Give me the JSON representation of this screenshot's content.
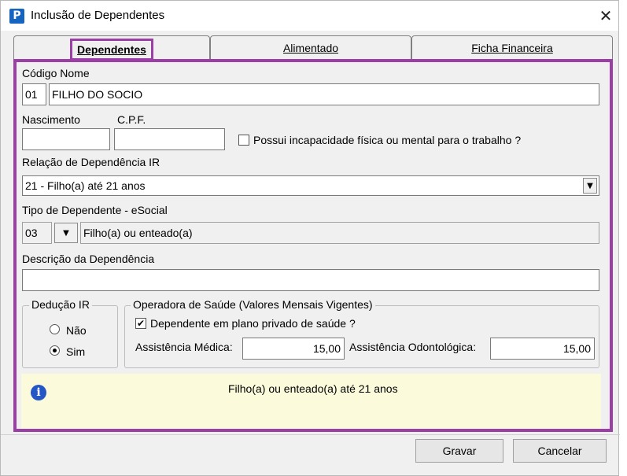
{
  "window": {
    "title": "Inclusão de Dependentes"
  },
  "tabs": [
    {
      "label": "Dependentes",
      "active": true
    },
    {
      "label": "Alimentado",
      "active": false
    },
    {
      "label": "Ficha Financeira",
      "active": false
    }
  ],
  "form": {
    "codigo_nome_label": "Código Nome",
    "codigo_value": "01",
    "nome_value": "FILHO DO SOCIO",
    "nascimento_label": "Nascimento",
    "nascimento_value": "",
    "cpf_label": "C.P.F.",
    "cpf_value": "",
    "incapacidade_label": "Possui incapacidade física ou mental para o trabalho ?",
    "incapacidade_checked": false,
    "relacao_label": "Relação de Dependência IR",
    "relacao_value": "21 - Filho(a) até 21 anos",
    "tipo_label": "Tipo de Dependente - eSocial",
    "tipo_code": "03",
    "tipo_desc": "Filho(a) ou enteado(a)",
    "descricao_label": "Descrição da Dependência",
    "descricao_value": ""
  },
  "deducao": {
    "legend": "Dedução IR",
    "options": [
      {
        "label": "Não",
        "selected": false
      },
      {
        "label": "Sim",
        "selected": true
      }
    ]
  },
  "operadora": {
    "legend": "Operadora de Saúde (Valores Mensais Vigentes)",
    "plano_label": "Dependente em plano privado de saúde ?",
    "plano_checked": true,
    "medica_label": "Assistência Médica:",
    "medica_value": "15,00",
    "odonto_label": "Assistência Odontológica:",
    "odonto_value": "15,00"
  },
  "info": {
    "text": "Filho(a) ou enteado(a) até 21 anos"
  },
  "buttons": {
    "gravar": "Gravar",
    "cancelar": "Cancelar"
  },
  "colors": {
    "highlight": "#9b3fa7",
    "info_bg": "#fbfbdc",
    "app_icon": "#1565c0"
  }
}
